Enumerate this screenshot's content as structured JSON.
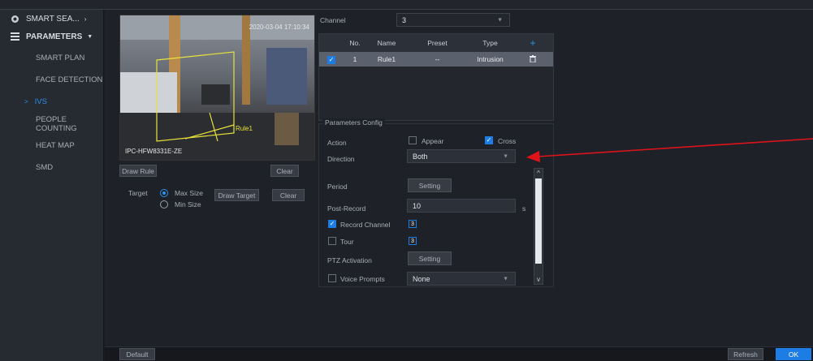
{
  "sidebar": {
    "header_smart": "SMART SEA...",
    "header_params": "PARAMETERS",
    "items": [
      {
        "label": "SMART PLAN"
      },
      {
        "label": "FACE DETECTION"
      },
      {
        "label": "IVS"
      },
      {
        "label": "PEOPLE COUNTING"
      },
      {
        "label": "HEAT MAP"
      },
      {
        "label": "SMD"
      }
    ]
  },
  "video": {
    "timestamp": "2020-03-04 17:10:34",
    "camera_name": "IPC-HFW8331E-ZE",
    "rule_label": "Rule1"
  },
  "left_buttons": {
    "draw_rule": "Draw Rule",
    "clear": "Clear",
    "target_label": "Target",
    "max_size": "Max Size",
    "min_size": "Min Size",
    "draw_target": "Draw Target",
    "clear2": "Clear"
  },
  "channel": {
    "label": "Channel",
    "value": "3"
  },
  "table": {
    "headers": [
      "No.",
      "Name",
      "Preset",
      "Type"
    ],
    "rows": [
      {
        "no": "1",
        "name": "Rule1",
        "preset": "--",
        "type": "Intrusion"
      }
    ]
  },
  "config": {
    "legend": "Parameters Config",
    "action_label": "Action",
    "appear": "Appear",
    "cross": "Cross",
    "direction_label": "Direction",
    "direction_value": "Both",
    "period_label": "Period",
    "setting": "Setting",
    "post_record_label": "Post-Record",
    "post_record_value": "10",
    "post_record_unit": "s",
    "record_channel": "Record Channel",
    "record_channel_num": "3",
    "tour": "Tour",
    "tour_num": "3",
    "ptz_label": "PTZ Activation",
    "ptz_setting": "Setting",
    "voice_prompts": "Voice Prompts",
    "voice_value": "None"
  },
  "footer": {
    "default": "Default",
    "refresh": "Refresh",
    "ok": "OK"
  },
  "colors": {
    "accent": "#1d7de5",
    "arrow": "#e0131a"
  }
}
